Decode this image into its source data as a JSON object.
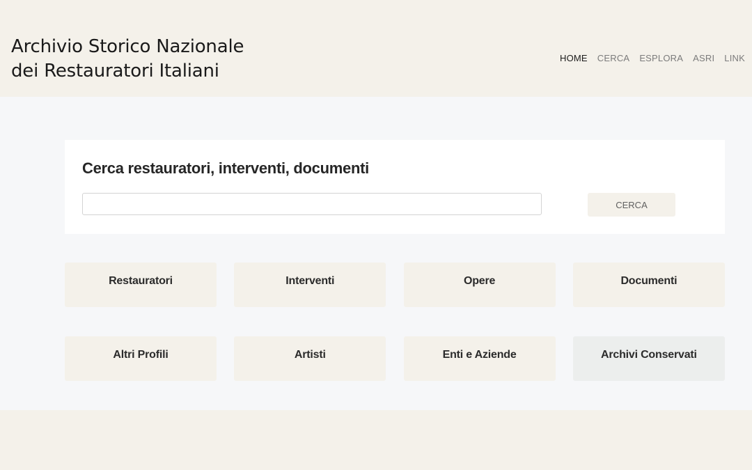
{
  "header": {
    "title_line1": "Archivio Storico Nazionale",
    "title_line2": "dei Restauratori Italiani",
    "nav": [
      {
        "label": "HOME",
        "active": true
      },
      {
        "label": "CERCA"
      },
      {
        "label": "ESPLORA"
      },
      {
        "label": "ASRI"
      },
      {
        "label": "LINK"
      }
    ]
  },
  "search": {
    "title": "Cerca restauratori, interventi, documenti",
    "input_value": "",
    "input_placeholder": "",
    "button_label": "CERCA"
  },
  "categories": [
    {
      "label": "Restauratori"
    },
    {
      "label": "Interventi"
    },
    {
      "label": "Opere"
    },
    {
      "label": "Documenti"
    },
    {
      "label": "Altri Profili"
    },
    {
      "label": "Artisti"
    },
    {
      "label": "Enti e Aziende"
    },
    {
      "label": "Archivi Conservati",
      "highlighted": true
    }
  ],
  "colors": {
    "beige": "#f4f1ea",
    "main_bg": "#f6f7f9",
    "card_bg": "#ffffff",
    "highlight_tile": "#eceeed",
    "nav_active": "#1a1a1a",
    "nav_inactive": "#7b7b7b"
  }
}
